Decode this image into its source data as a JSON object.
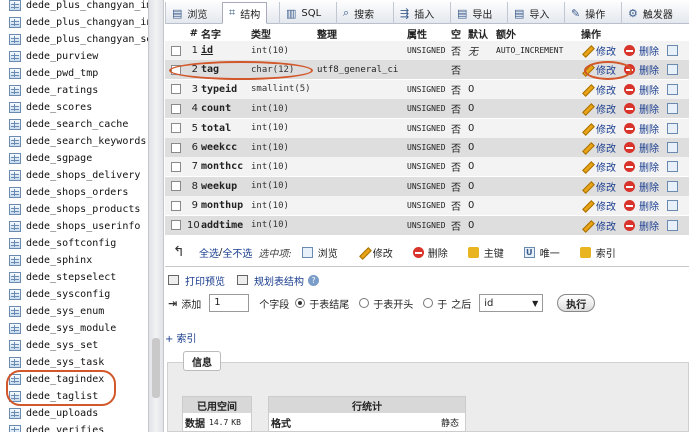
{
  "sidebar": {
    "items": [
      "dede_plus_changyan_imp",
      "dede_plus_changyan_ins",
      "dede_plus_changyan_set",
      "dede_purview",
      "dede_pwd_tmp",
      "dede_ratings",
      "dede_scores",
      "dede_search_cache",
      "dede_search_keywords",
      "dede_sgpage",
      "dede_shops_delivery",
      "dede_shops_orders",
      "dede_shops_products",
      "dede_shops_userinfo",
      "dede_softconfig",
      "dede_sphinx",
      "dede_stepselect",
      "dede_sysconfig",
      "dede_sys_enum",
      "dede_sys_module",
      "dede_sys_set",
      "dede_sys_task",
      "dede_tagindex",
      "dede_taglist",
      "dede_uploads",
      "dede_verifies"
    ]
  },
  "tabs": {
    "browse": "浏览",
    "structure": "结构",
    "sql": "SQL",
    "search": "搜索",
    "insert": "插入",
    "export": "导出",
    "import": "导入",
    "operations": "操作",
    "triggers": "触发器"
  },
  "table_header": {
    "num": "#",
    "name": "名字",
    "type": "类型",
    "collation": "整理",
    "attributes": "属性",
    "null": "空",
    "default": "默认",
    "extra": "额外",
    "action": "操作"
  },
  "actions": {
    "edit": "修改",
    "drop": "删除"
  },
  "rows": [
    {
      "num": "1",
      "name": "id",
      "type": "int(10)",
      "collation": "",
      "attributes": "UNSIGNED",
      "null": "否",
      "default": "无",
      "extra": "AUTO_INCREMENT"
    },
    {
      "num": "2",
      "name": "tag",
      "type": "char(12)",
      "collation": "utf8_general_ci",
      "attributes": "",
      "null": "否",
      "default": "",
      "extra": ""
    },
    {
      "num": "3",
      "name": "typeid",
      "type": "smallint(5)",
      "collation": "",
      "attributes": "UNSIGNED",
      "null": "否",
      "default": "0",
      "extra": ""
    },
    {
      "num": "4",
      "name": "count",
      "type": "int(10)",
      "collation": "",
      "attributes": "UNSIGNED",
      "null": "否",
      "default": "0",
      "extra": ""
    },
    {
      "num": "5",
      "name": "total",
      "type": "int(10)",
      "collation": "",
      "attributes": "UNSIGNED",
      "null": "否",
      "default": "0",
      "extra": ""
    },
    {
      "num": "6",
      "name": "weekcc",
      "type": "int(10)",
      "collation": "",
      "attributes": "UNSIGNED",
      "null": "否",
      "default": "0",
      "extra": ""
    },
    {
      "num": "7",
      "name": "monthcc",
      "type": "int(10)",
      "collation": "",
      "attributes": "UNSIGNED",
      "null": "否",
      "default": "0",
      "extra": ""
    },
    {
      "num": "8",
      "name": "weekup",
      "type": "int(10)",
      "collation": "",
      "attributes": "UNSIGNED",
      "null": "否",
      "default": "0",
      "extra": ""
    },
    {
      "num": "9",
      "name": "monthup",
      "type": "int(10)",
      "collation": "",
      "attributes": "UNSIGNED",
      "null": "否",
      "default": "0",
      "extra": ""
    },
    {
      "num": "10",
      "name": "addtime",
      "type": "int(10)",
      "collation": "",
      "attributes": "UNSIGNED",
      "null": "否",
      "default": "0",
      "extra": ""
    }
  ],
  "bulk": {
    "check_all": "全选",
    "separator": " / ",
    "uncheck_all": "全不选",
    "with_selected": "选中项:",
    "browse": "浏览",
    "edit": "修改",
    "drop": "删除",
    "primary": "主键",
    "unique": "唯一",
    "index": "索引"
  },
  "print_view": "打印预览",
  "propose_structure": "规划表结构",
  "add_field": {
    "label": "添加",
    "count": "1",
    "unit": "个字段",
    "at_end": "于表结尾",
    "at_start": "于表开头",
    "after": "于",
    "after_suffix": "之后",
    "after_field": "id",
    "go": "执行"
  },
  "index_link": "+ 索引",
  "info": {
    "legend": "信息",
    "space_header": "已用空间",
    "space_label": "数据",
    "space_value": "14.7",
    "space_unit": "KB",
    "stats_header": "行统计",
    "format_label": "格式",
    "format_value": "静态"
  },
  "colors": {
    "highlight": "#d2572a",
    "link": "#1a3d8f"
  }
}
